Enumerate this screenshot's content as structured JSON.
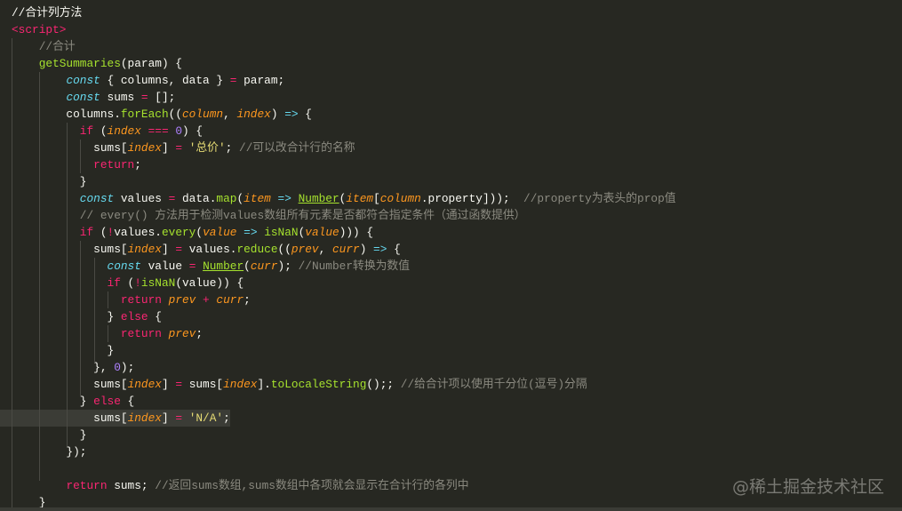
{
  "code": [
    [
      [
        "c",
        "//合计列方法"
      ]
    ],
    [
      [
        "tag",
        "<script>"
      ]
    ],
    [
      [
        "",
        "    "
      ],
      [
        "cm",
        "//合计"
      ]
    ],
    [
      [
        "",
        "    "
      ],
      [
        "fn",
        "getSummaries"
      ],
      [
        "",
        "(param) {"
      ]
    ],
    [
      [
        "",
        "        "
      ],
      [
        "st",
        "const"
      ],
      [
        "",
        " { columns, data } "
      ],
      [
        "op",
        "="
      ],
      [
        "",
        " param;"
      ]
    ],
    [
      [
        "",
        "        "
      ],
      [
        "st",
        "const"
      ],
      [
        "",
        " sums "
      ],
      [
        "op",
        "="
      ],
      [
        "",
        " [];"
      ]
    ],
    [
      [
        "",
        "        columns."
      ],
      [
        "fn",
        "forEach"
      ],
      [
        "",
        "(("
      ],
      [
        "pa",
        "column"
      ],
      [
        "",
        ", "
      ],
      [
        "pa",
        "index"
      ],
      [
        "",
        ") "
      ],
      [
        "st",
        "=>"
      ],
      [
        "",
        " {"
      ]
    ],
    [
      [
        "",
        "          "
      ],
      [
        "kw",
        "if"
      ],
      [
        "",
        " ("
      ],
      [
        "pa",
        "index"
      ],
      [
        "",
        " "
      ],
      [
        "op",
        "==="
      ],
      [
        "",
        " "
      ],
      [
        "nu",
        "0"
      ],
      [
        "",
        ") {"
      ]
    ],
    [
      [
        "",
        "            sums["
      ],
      [
        "pa",
        "index"
      ],
      [
        "",
        "] "
      ],
      [
        "op",
        "="
      ],
      [
        "",
        " "
      ],
      [
        "str",
        "'总价'"
      ],
      [
        "",
        "; "
      ],
      [
        "cm",
        "//可以改合计行的名称"
      ]
    ],
    [
      [
        "",
        "            "
      ],
      [
        "kw",
        "return"
      ],
      [
        "",
        ";"
      ]
    ],
    [
      [
        "",
        "          }"
      ]
    ],
    [
      [
        "",
        "          "
      ],
      [
        "st",
        "const"
      ],
      [
        "",
        " values "
      ],
      [
        "op",
        "="
      ],
      [
        "",
        " data."
      ],
      [
        "fn",
        "map"
      ],
      [
        "",
        "("
      ],
      [
        "pa",
        "item"
      ],
      [
        "",
        " "
      ],
      [
        "st",
        "=>"
      ],
      [
        "",
        " "
      ],
      [
        "fnu",
        "Number"
      ],
      [
        "",
        "("
      ],
      [
        "pa",
        "item"
      ],
      [
        "",
        "["
      ],
      [
        "pa",
        "column"
      ],
      [
        "",
        ".property]));  "
      ],
      [
        "cm",
        "//property为表头的prop值"
      ]
    ],
    [
      [
        "",
        "          "
      ],
      [
        "cm",
        "// every() 方法用于检测values数组所有元素是否都符合指定条件（通过函数提供）"
      ]
    ],
    [
      [
        "",
        "          "
      ],
      [
        "kw",
        "if"
      ],
      [
        "",
        " ("
      ],
      [
        "op",
        "!"
      ],
      [
        "",
        "values."
      ],
      [
        "fn",
        "every"
      ],
      [
        "",
        "("
      ],
      [
        "pa",
        "value"
      ],
      [
        "",
        " "
      ],
      [
        "st",
        "=>"
      ],
      [
        "",
        " "
      ],
      [
        "fn",
        "isNaN"
      ],
      [
        "",
        "("
      ],
      [
        "pa",
        "value"
      ],
      [
        "",
        ")))"
      ],
      [
        "",
        " {"
      ]
    ],
    [
      [
        "",
        "            sums["
      ],
      [
        "pa",
        "index"
      ],
      [
        "",
        "] "
      ],
      [
        "op",
        "="
      ],
      [
        "",
        " values."
      ],
      [
        "fn",
        "reduce"
      ],
      [
        "",
        "(("
      ],
      [
        "pa",
        "prev"
      ],
      [
        "",
        ", "
      ],
      [
        "pa",
        "curr"
      ],
      [
        "",
        ") "
      ],
      [
        "st",
        "=>"
      ],
      [
        "",
        " {"
      ]
    ],
    [
      [
        "",
        "              "
      ],
      [
        "st",
        "const"
      ],
      [
        "",
        " value "
      ],
      [
        "op",
        "="
      ],
      [
        "",
        " "
      ],
      [
        "fnu",
        "Number"
      ],
      [
        "",
        "("
      ],
      [
        "pa",
        "curr"
      ],
      [
        "",
        "); "
      ],
      [
        "cm",
        "//Number转换为数值"
      ]
    ],
    [
      [
        "",
        "              "
      ],
      [
        "kw",
        "if"
      ],
      [
        "",
        " ("
      ],
      [
        "op",
        "!"
      ],
      [
        "fn",
        "isNaN"
      ],
      [
        "",
        "(value)) {"
      ]
    ],
    [
      [
        "",
        "                "
      ],
      [
        "kw",
        "return"
      ],
      [
        "",
        " "
      ],
      [
        "pa",
        "prev"
      ],
      [
        "",
        " "
      ],
      [
        "op",
        "+"
      ],
      [
        "",
        " "
      ],
      [
        "pa",
        "curr"
      ],
      [
        "",
        ";"
      ]
    ],
    [
      [
        "",
        "              } "
      ],
      [
        "kw",
        "else"
      ],
      [
        "",
        " {"
      ]
    ],
    [
      [
        "",
        "                "
      ],
      [
        "kw",
        "return"
      ],
      [
        "",
        " "
      ],
      [
        "pa",
        "prev"
      ],
      [
        "",
        ";"
      ]
    ],
    [
      [
        "",
        "              }"
      ]
    ],
    [
      [
        "",
        "            }, "
      ],
      [
        "nu",
        "0"
      ],
      [
        "",
        ");"
      ]
    ],
    [
      [
        "",
        "            sums["
      ],
      [
        "pa",
        "index"
      ],
      [
        "",
        "] "
      ],
      [
        "op",
        "="
      ],
      [
        "",
        " sums["
      ],
      [
        "pa",
        "index"
      ],
      [
        "",
        "]."
      ],
      [
        "fn",
        "toLocaleString"
      ],
      [
        "",
        "();; "
      ],
      [
        "cm",
        "//给合计项以使用千分位(逗号)分隔"
      ]
    ],
    [
      [
        "",
        "          } "
      ],
      [
        "kw",
        "else"
      ],
      [
        "",
        " {"
      ]
    ],
    [
      [
        "",
        "            sums["
      ],
      [
        "pa",
        "index"
      ],
      [
        "",
        "] "
      ],
      [
        "op",
        "="
      ],
      [
        "",
        " "
      ],
      [
        "str",
        "'N/A'"
      ],
      [
        "",
        ";"
      ]
    ],
    [
      [
        "",
        "          }"
      ]
    ],
    [
      [
        "",
        "        });"
      ]
    ],
    [
      [
        "",
        ""
      ]
    ],
    [
      [
        "",
        "        "
      ],
      [
        "kw",
        "return"
      ],
      [
        "",
        " sums; "
      ],
      [
        "cm",
        "//返回sums数组,sums数组中各项就会显示在合计行的各列中"
      ]
    ],
    [
      [
        "",
        "    }"
      ]
    ]
  ],
  "highlighted_line": 25,
  "watermark": "@稀土掘金技术社区"
}
